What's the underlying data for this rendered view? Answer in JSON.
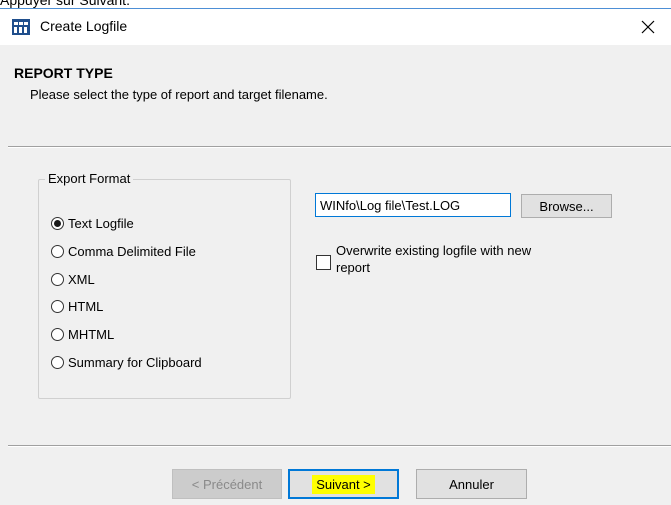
{
  "caption": "Appuyer sur Suivant.",
  "window": {
    "title": "Create Logfile",
    "icon": "app-grid-icon",
    "close_glyph": "✕"
  },
  "header": {
    "title": "REPORT TYPE",
    "subtitle": "Please select the type of report and target filename."
  },
  "export_format": {
    "label": "Export Format",
    "options": [
      {
        "label": "Text Logfile",
        "checked": true
      },
      {
        "label": "Comma Delimited File",
        "checked": false
      },
      {
        "label": "XML",
        "checked": false
      },
      {
        "label": "HTML",
        "checked": false
      },
      {
        "label": "MHTML",
        "checked": false
      },
      {
        "label": "Summary for Clipboard",
        "checked": false
      }
    ]
  },
  "target": {
    "filename_value": "WINfo\\Log file\\Test.LOG",
    "browse_label": "Browse...",
    "overwrite_label": "Overwrite existing logfile with new report",
    "overwrite_checked": false
  },
  "footer": {
    "prev_label": "< Précédent",
    "next_label": "Suivant >",
    "cancel_label": "Annuler"
  },
  "colors": {
    "focus": "#0078d7",
    "highlight": "#ffff00"
  }
}
